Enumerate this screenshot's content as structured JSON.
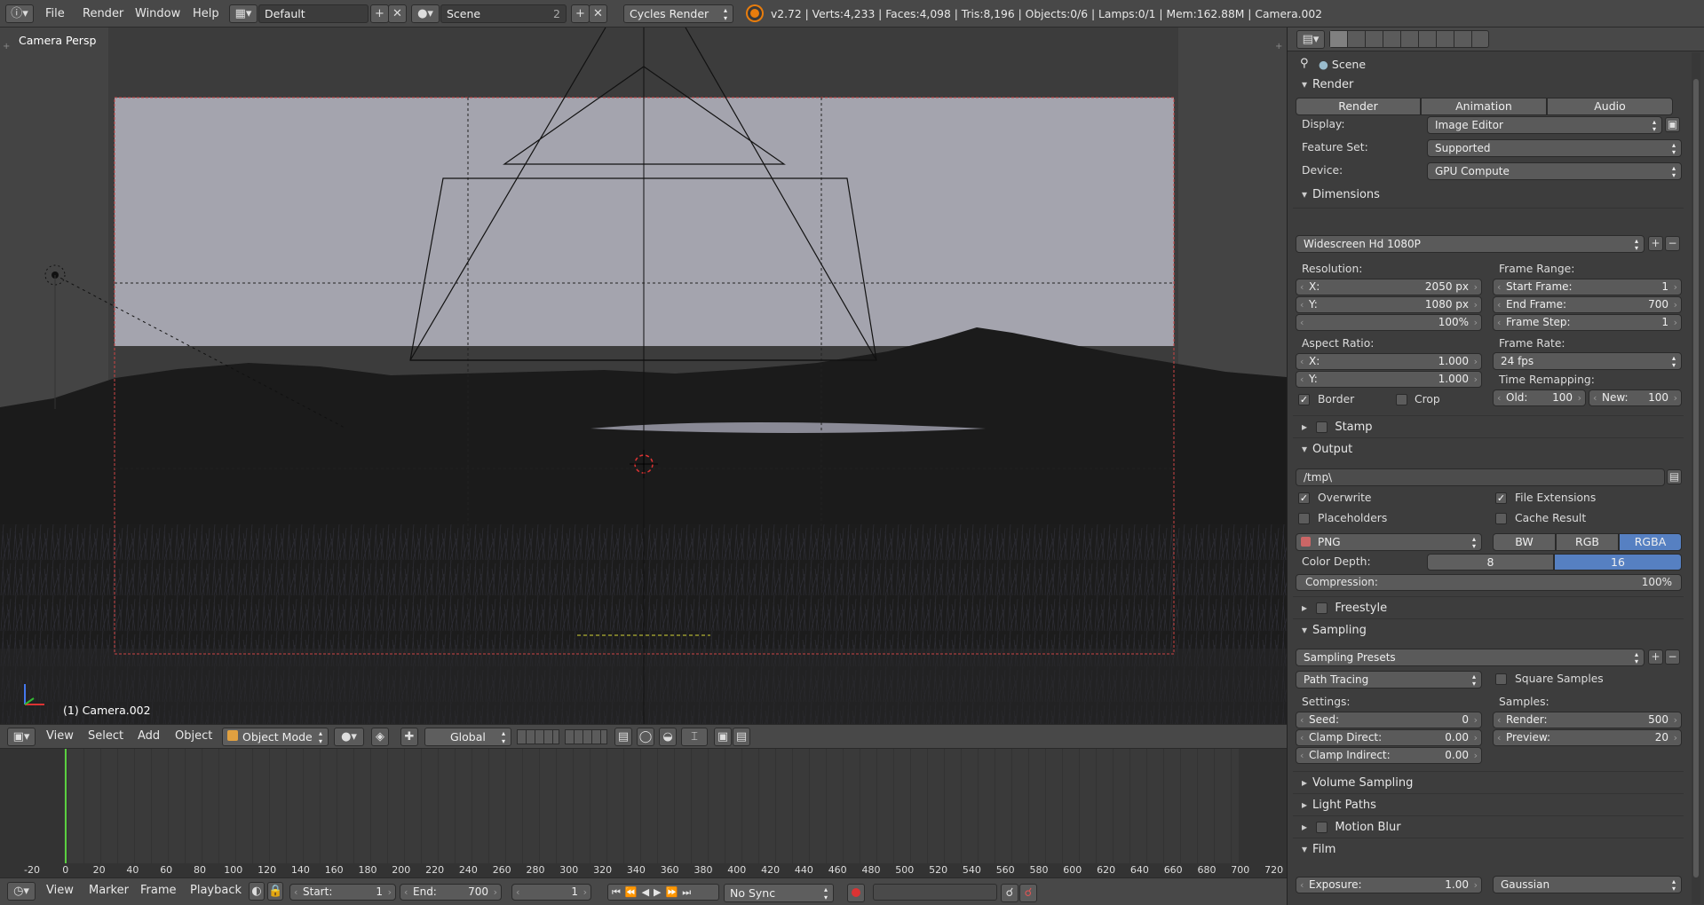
{
  "topbar": {
    "menus": [
      "File",
      "Render",
      "Window",
      "Help"
    ],
    "layout": "Default",
    "scene": "Scene",
    "scene_users": "2",
    "engine": "Cycles Render",
    "stats": "v2.72 | Verts:4,233 | Faces:4,098 | Tris:8,196 | Objects:0/6 | Lamps:0/1 | Mem:162.88M | Camera.002"
  },
  "viewport": {
    "view_name": "Camera Persp",
    "object_label": "(1) Camera.002"
  },
  "viewport_header": {
    "menus": [
      "View",
      "Select",
      "Add",
      "Object"
    ],
    "mode": "Object Mode",
    "orientation": "Global"
  },
  "timeline": {
    "ticks": [
      "-20",
      "0",
      "20",
      "40",
      "60",
      "80",
      "100",
      "120",
      "140",
      "160",
      "180",
      "200",
      "220",
      "240",
      "260",
      "280",
      "300",
      "320",
      "340",
      "360",
      "380",
      "400",
      "420",
      "440",
      "460",
      "480",
      "500",
      "520",
      "540",
      "560",
      "580",
      "600",
      "620",
      "640",
      "660",
      "680",
      "700",
      "720"
    ],
    "current_frame_pos": 0
  },
  "timeline_header": {
    "menus": [
      "View",
      "Marker",
      "Frame",
      "Playback"
    ],
    "start_label": "Start:",
    "start_value": "1",
    "end_label": "End:",
    "end_value": "700",
    "current": "1",
    "sync": "No Sync"
  },
  "props": {
    "breadcrumb": "Scene",
    "render_panel": {
      "title": "Render",
      "buttons": [
        "Render",
        "Animation",
        "Audio"
      ],
      "display_label": "Display:",
      "display_value": "Image Editor",
      "feature_label": "Feature Set:",
      "feature_value": "Supported",
      "device_label": "Device:",
      "device_value": "GPU Compute"
    },
    "dimensions_panel": {
      "title": "Dimensions",
      "preset": "Widescreen Hd 1080P",
      "resolution_label": "Resolution:",
      "res_x_label": "X:",
      "res_x": "2050 px",
      "res_y_label": "Y:",
      "res_y": "1080 px",
      "res_pct": "100%",
      "frame_range_label": "Frame Range:",
      "start_label": "Start Frame:",
      "start": "1",
      "end_label": "End Frame:",
      "end": "700",
      "step_label": "Frame Step:",
      "step": "1",
      "aspect_label": "Aspect Ratio:",
      "asp_x_label": "X:",
      "asp_x": "1.000",
      "asp_y_label": "Y:",
      "asp_y": "1.000",
      "frame_rate_label": "Frame Rate:",
      "frame_rate": "24 fps",
      "time_remap_label": "Time Remapping:",
      "old_label": "Old:",
      "old": "100",
      "new_label": "New:",
      "new": "100",
      "border_label": "Border",
      "border_checked": true,
      "crop_label": "Crop",
      "crop_checked": false
    },
    "stamp_panel": {
      "title": "Stamp"
    },
    "output_panel": {
      "title": "Output",
      "path": "/tmp\\",
      "overwrite": "Overwrite",
      "file_ext": "File Extensions",
      "placeholders": "Placeholders",
      "cache": "Cache Result",
      "format": "PNG",
      "color_modes": [
        "BW",
        "RGB",
        "RGBA"
      ],
      "color_mode_selected": "RGBA",
      "depth_label": "Color Depth:",
      "depths": [
        "8",
        "16"
      ],
      "depth_selected": "16",
      "compression_label": "Compression:",
      "compression": "100%"
    },
    "freestyle_panel": {
      "title": "Freestyle"
    },
    "sampling_panel": {
      "title": "Sampling",
      "presets": "Sampling Presets",
      "integrator": "Path Tracing",
      "square_samples": "Square Samples",
      "settings_label": "Settings:",
      "seed_label": "Seed:",
      "seed": "0",
      "clamp_direct_label": "Clamp Direct:",
      "clamp_direct": "0.00",
      "clamp_indirect_label": "Clamp Indirect:",
      "clamp_indirect": "0.00",
      "samples_label": "Samples:",
      "render_label": "Render:",
      "render": "500",
      "preview_label": "Preview:",
      "preview": "20"
    },
    "volume_panel": {
      "title": "Volume Sampling"
    },
    "lightpaths_panel": {
      "title": "Light Paths"
    },
    "motionblur_panel": {
      "title": "Motion Blur"
    },
    "film_panel": {
      "title": "Film",
      "exposure_label": "Exposure:",
      "exposure": "1.00",
      "filter": "Gaussian"
    }
  }
}
